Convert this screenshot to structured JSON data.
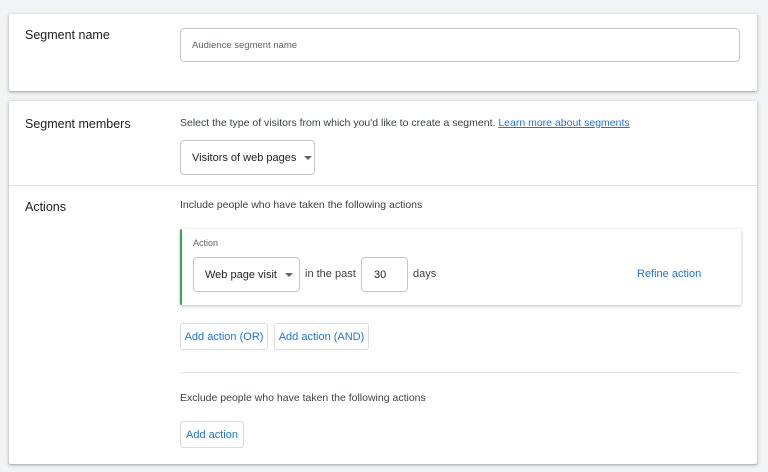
{
  "segment_name": {
    "label": "Segment name",
    "placeholder": "Audience segment name"
  },
  "segment_members": {
    "label": "Segment members",
    "description": "Select the type of visitors from which you'd like to create a segment.",
    "learn_more_link": "Learn more about segments",
    "visitor_type_selected": "Visitors of web pages"
  },
  "actions": {
    "label": "Actions",
    "include_text": "Include people who have taken the following actions",
    "action_card": {
      "label": "Action",
      "action_type_selected": "Web page visit",
      "in_the_past_text": "in the past",
      "days_value": "30",
      "days_text": "days",
      "refine_label": "Refine action"
    },
    "add_or_label": "Add action (OR)",
    "add_and_label": "Add action (AND)",
    "exclude_text": "Exclude people who have taken the following actions",
    "add_action_label": "Add action"
  },
  "colors": {
    "accent": "#1a73e8",
    "action_border": "#34a853",
    "background": "#f1f3f4"
  }
}
